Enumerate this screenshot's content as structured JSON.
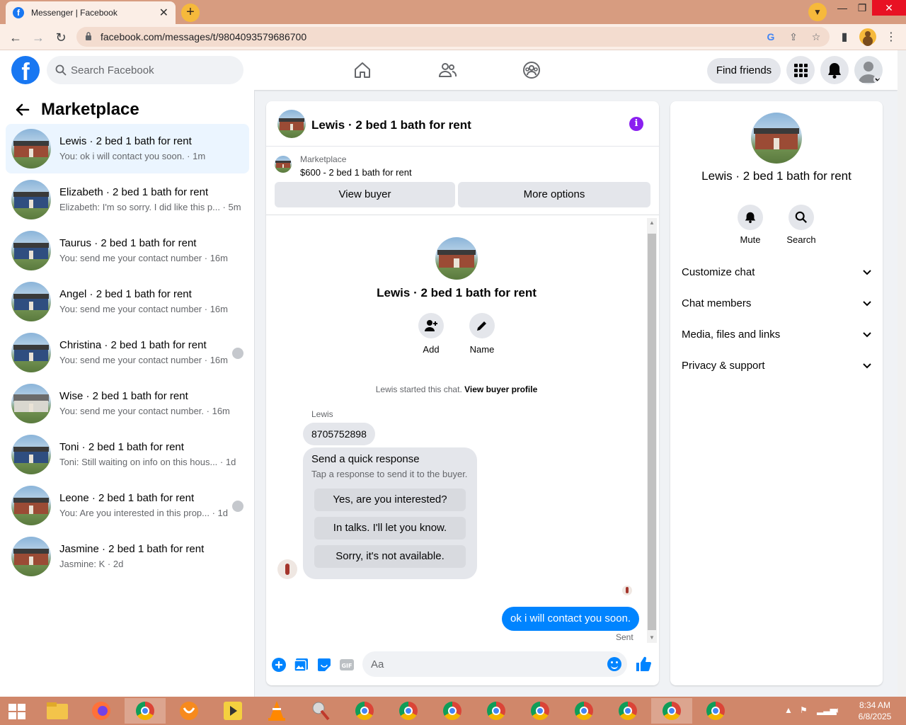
{
  "browser": {
    "tab_title": "Messenger | Facebook",
    "tab_close": "✕",
    "new_tab": "+",
    "url": "facebook.com/messages/t/9804093579686700",
    "win_minimize": "—",
    "win_restore": "❐",
    "win_close": "✕"
  },
  "fb": {
    "search_placeholder": "Search Facebook",
    "find_friends": "Find friends"
  },
  "sidebar": {
    "title": "Marketplace",
    "conversations": [
      {
        "title": "Lewis · 2 bed 1 bath for rent",
        "sub": "You: ok i will contact you soon. · 1m",
        "house": "brick",
        "seen": false
      },
      {
        "title": "Elizabeth · 2 bed 1 bath for rent",
        "sub": "Elizabeth: I'm so sorry. I did like this p... · 5m",
        "house": "blue",
        "seen": false
      },
      {
        "title": "Taurus · 2 bed 1 bath for rent",
        "sub": "You: send me your contact number · 16m",
        "house": "blue",
        "seen": false
      },
      {
        "title": "Angel · 2 bed 1 bath for rent",
        "sub": "You: send me your contact number · 16m",
        "house": "blue",
        "seen": false
      },
      {
        "title": "Christina · 2 bed 1 bath for rent",
        "sub": "You: send me your contact number · 16m",
        "house": "blue",
        "seen": true
      },
      {
        "title": "Wise · 2 bed 1 bath for rent",
        "sub": "You: send me your contact number. · 16m",
        "house": "white",
        "seen": false
      },
      {
        "title": "Toni · 2 bed 1 bath for rent",
        "sub": "Toni: Still waiting on info on this hous... · 1d",
        "house": "blue",
        "seen": false
      },
      {
        "title": "Leone · 2 bed 1 bath for rent",
        "sub": "You: Are you interested in this prop... · 1d",
        "house": "brick",
        "seen": true
      },
      {
        "title": "Jasmine · 2 bed 1 bath for rent",
        "sub": "Jasmine: K · 2d",
        "house": "brick",
        "seen": false
      }
    ]
  },
  "chat": {
    "title": "Lewis · 2 bed 1 bath for rent",
    "marketplace_label": "Marketplace",
    "listing": "$600 - 2 bed 1 bath for rent",
    "view_buyer": "View buyer",
    "more_options": "More options",
    "intro_title": "Lewis · 2 bed 1 bath for rent",
    "add_label": "Add",
    "name_label": "Name",
    "started_text": "Lewis started this chat.",
    "started_link": "View buyer profile",
    "sender": "Lewis",
    "incoming_message": "8705752898",
    "qr_title": "Send a quick response",
    "qr_sub": "Tap a response to send it to the buyer.",
    "quick_responses": [
      "Yes, are you interested?",
      "In talks. I'll let you know.",
      "Sorry, it's not available."
    ],
    "outgoing_message": "ok i will contact you soon.",
    "sent_label": "Sent",
    "composer_placeholder": "Aa"
  },
  "right_panel": {
    "title": "Lewis · 2 bed 1 bath for rent",
    "mute": "Mute",
    "search": "Search",
    "sections": [
      "Customize chat",
      "Chat members",
      "Media, files and links",
      "Privacy & support"
    ]
  },
  "taskbar": {
    "time": "8:34 AM",
    "date": "6/8/2025"
  },
  "colors": {
    "fb_blue": "#1877f2",
    "messenger_blue": "#0084ff",
    "tab_bar": "#d79c80",
    "taskbar": "#d0876a"
  }
}
